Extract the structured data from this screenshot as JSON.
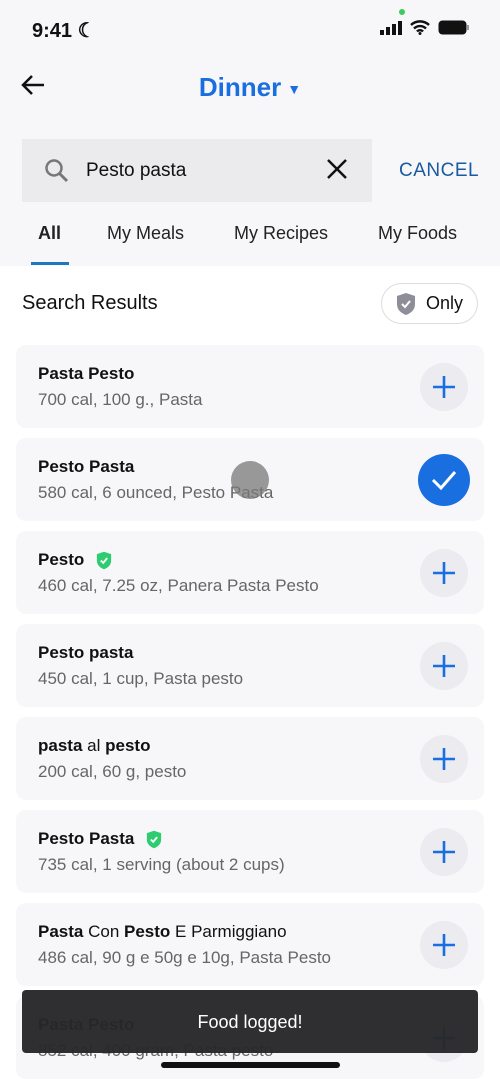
{
  "status": {
    "time": "9:41"
  },
  "header": {
    "title": "Dinner"
  },
  "search": {
    "value": "Pesto pasta",
    "cancel": "CANCEL"
  },
  "tabs": [
    {
      "label": "All",
      "active": true
    },
    {
      "label": "My Meals"
    },
    {
      "label": "My Recipes"
    },
    {
      "label": "My Foods"
    }
  ],
  "results": {
    "heading": "Search Results",
    "filter_label": "Only",
    "items": [
      {
        "title": [
          {
            "t": "Pasta Pesto",
            "b": true
          }
        ],
        "sub": "700 cal, 100 g., Pasta",
        "checked": false,
        "verified": false
      },
      {
        "title": [
          {
            "t": "Pesto Pasta",
            "b": true
          }
        ],
        "sub": "580 cal, 6 ounced, Pesto Pasta",
        "checked": true,
        "verified": false
      },
      {
        "title": [
          {
            "t": "Pesto",
            "b": true
          }
        ],
        "sub": "460 cal, 7.25 oz, Panera Pasta Pesto",
        "checked": false,
        "verified": true
      },
      {
        "title": [
          {
            "t": "Pesto pasta",
            "b": true
          }
        ],
        "sub": "450 cal, 1 cup, Pasta pesto",
        "checked": false,
        "verified": false
      },
      {
        "title": [
          {
            "t": "pasta",
            "b": true
          },
          {
            "t": " al ",
            "b": false
          },
          {
            "t": "pesto",
            "b": true
          }
        ],
        "sub": "200 cal, 60 g, pesto",
        "checked": false,
        "verified": false
      },
      {
        "title": [
          {
            "t": "Pesto Pasta",
            "b": true
          }
        ],
        "sub": "735 cal, 1 serving (about 2 cups)",
        "checked": false,
        "verified": true
      },
      {
        "title": [
          {
            "t": "Pasta",
            "b": true
          },
          {
            "t": " Con ",
            "b": false
          },
          {
            "t": "Pesto",
            "b": true
          },
          {
            "t": " E Parmiggiano",
            "b": false
          }
        ],
        "sub": "486 cal, 90 g e 50g e 10g, Pasta Pesto",
        "checked": false,
        "verified": false
      },
      {
        "title": [
          {
            "t": "Pasta Pesto",
            "b": true
          }
        ],
        "sub": "852 cal, 400 gram, Pasta pesto",
        "checked": false,
        "verified": false
      }
    ]
  },
  "toast": "Food logged!",
  "colors": {
    "accent": "#1a6fe0",
    "verified": "#2ecc71"
  }
}
